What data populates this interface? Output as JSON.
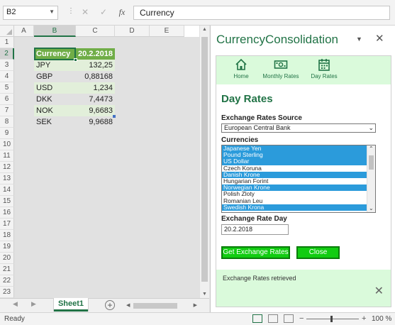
{
  "formula_bar": {
    "name_box": "B2",
    "cancel_glyph": "✕",
    "enter_glyph": "✓",
    "fx_label": "fx",
    "formula": "Currency"
  },
  "grid": {
    "columns": [
      "A",
      "B",
      "C",
      "D",
      "E"
    ],
    "rows": [
      "1",
      "2",
      "3",
      "4",
      "5",
      "6",
      "7",
      "8",
      "9",
      "10",
      "11",
      "12",
      "13",
      "14",
      "15",
      "16",
      "17",
      "18",
      "19",
      "20",
      "21",
      "22",
      "23"
    ],
    "table": {
      "header": [
        "Currency",
        "20.2.2018"
      ],
      "rows": [
        [
          "JPY",
          "132,25"
        ],
        [
          "GBP",
          "0,88168"
        ],
        [
          "USD",
          "1,234"
        ],
        [
          "DKK",
          "7,4473"
        ],
        [
          "NOK",
          "9,6683"
        ],
        [
          "SEK",
          "9,9688"
        ]
      ]
    }
  },
  "sheet_tabs": {
    "active": "Sheet1"
  },
  "status_bar": {
    "ready": "Ready",
    "zoom": "100 %"
  },
  "pane": {
    "title": "CurrencyConsolidation",
    "nav": [
      {
        "label": "Home",
        "icon": "home-icon"
      },
      {
        "label": "Monthly Rates",
        "icon": "money-icon"
      },
      {
        "label": "Day Rates",
        "icon": "calendar-icon"
      }
    ],
    "heading": "Day Rates",
    "source_label": "Exchange Rates Source",
    "source_value": "European Central Bank",
    "currencies_label": "Currencies",
    "currencies": [
      {
        "name": "Japanese Yen",
        "selected": true
      },
      {
        "name": "Pound Sterling",
        "selected": true
      },
      {
        "name": "US Dollar",
        "selected": true
      },
      {
        "name": "Czech Koruna",
        "selected": false
      },
      {
        "name": "Danish Krone",
        "selected": true
      },
      {
        "name": "Hungarian Forint",
        "selected": false
      },
      {
        "name": "Norwegian Krone",
        "selected": true
      },
      {
        "name": "Polish Zloty",
        "selected": false
      },
      {
        "name": "Romanian Leu",
        "selected": false
      },
      {
        "name": "Swedish Krona",
        "selected": true
      }
    ],
    "rate_day_label": "Exchange Rate Day",
    "rate_day_value": "20.2.2018",
    "get_button": "Get Exchange Rates",
    "close_button": "Close",
    "message": "Exchange Rates retrieved"
  },
  "colors": {
    "accent": "#217346",
    "header_fill": "#70ad47",
    "band_fill": "#e2efda",
    "button": "#12cc12",
    "nav_bg": "#dafadb",
    "list_selected": "#2b9bdb"
  }
}
